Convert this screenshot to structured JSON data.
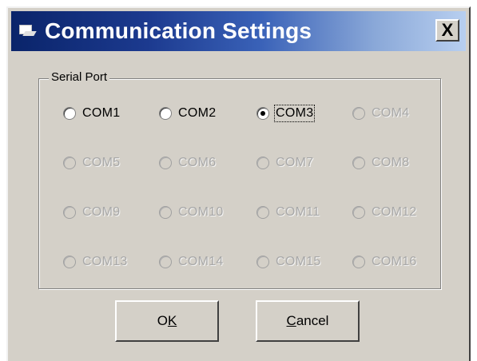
{
  "window": {
    "title": "Communication Settings",
    "close_label": "X"
  },
  "serial_port": {
    "label": "Serial Port",
    "selected": "COM3",
    "options": [
      {
        "label": "COM1",
        "enabled": true,
        "checked": false
      },
      {
        "label": "COM2",
        "enabled": true,
        "checked": false
      },
      {
        "label": "COM3",
        "enabled": true,
        "checked": true
      },
      {
        "label": "COM4",
        "enabled": false,
        "checked": false
      },
      {
        "label": "COM5",
        "enabled": false,
        "checked": false
      },
      {
        "label": "COM6",
        "enabled": false,
        "checked": false
      },
      {
        "label": "COM7",
        "enabled": false,
        "checked": false
      },
      {
        "label": "COM8",
        "enabled": false,
        "checked": false
      },
      {
        "label": "COM9",
        "enabled": false,
        "checked": false
      },
      {
        "label": "COM10",
        "enabled": false,
        "checked": false
      },
      {
        "label": "COM11",
        "enabled": false,
        "checked": false
      },
      {
        "label": "COM12",
        "enabled": false,
        "checked": false
      },
      {
        "label": "COM13",
        "enabled": false,
        "checked": false
      },
      {
        "label": "COM14",
        "enabled": false,
        "checked": false
      },
      {
        "label": "COM15",
        "enabled": false,
        "checked": false
      },
      {
        "label": "COM16",
        "enabled": false,
        "checked": false
      }
    ]
  },
  "buttons": {
    "ok": {
      "label": "OK",
      "mnemonic": "K"
    },
    "cancel": {
      "label": "Cancel",
      "mnemonic": "C"
    }
  },
  "icons": {
    "app": "terminal-icon",
    "close": "close-icon"
  }
}
